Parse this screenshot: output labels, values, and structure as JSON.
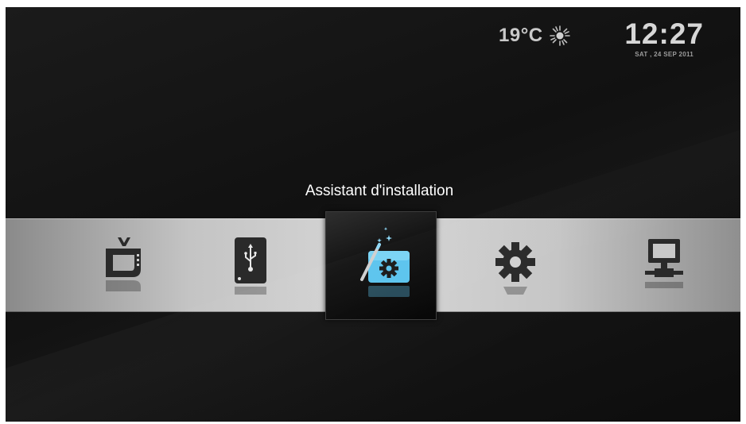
{
  "status": {
    "temperature": "19°C",
    "weather_icon": "sun-icon",
    "time": "12:27",
    "date": "SAT , 24 SEP 2011"
  },
  "menu": {
    "selected_title": "Assistant d'installation",
    "items": [
      {
        "icon": "tv-icon",
        "selected": false
      },
      {
        "icon": "usb-drive-icon",
        "selected": false
      },
      {
        "icon": "installation-wizard-icon",
        "selected": true
      },
      {
        "icon": "settings-gear-icon",
        "selected": false
      },
      {
        "icon": "network-computer-icon",
        "selected": false
      }
    ]
  },
  "colors": {
    "background": "#141414",
    "band_light": "#d6d6d6",
    "icon_dark": "#2a2a2a",
    "wizard_blue": "#5cc4ee",
    "text": "#ffffff"
  }
}
